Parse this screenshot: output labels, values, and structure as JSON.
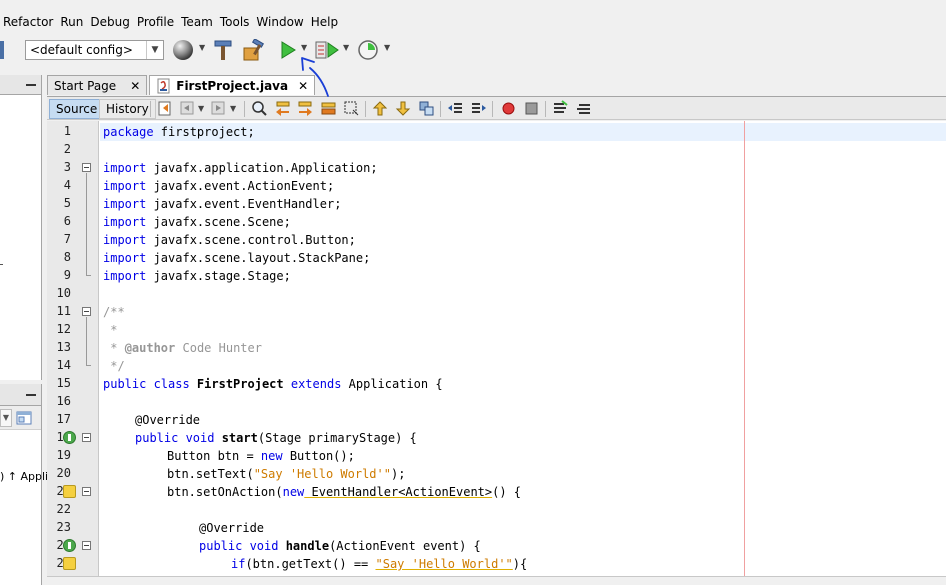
{
  "menu": [
    "Refactor",
    "Run",
    "Debug",
    "Profile",
    "Team",
    "Tools",
    "Window",
    "Help"
  ],
  "toolbar": {
    "config_value": "<default config>",
    "icons": [
      "globe-icon",
      "clean-hammer-icon",
      "build-icon",
      "run-icon",
      "debug-icon",
      "profile-icon"
    ]
  },
  "tabs": [
    {
      "label": "Start Page",
      "active": false
    },
    {
      "label": "FirstProject.java",
      "active": true
    }
  ],
  "editor_toolbar": {
    "source": "Source",
    "history": "History"
  },
  "left_panel": {
    "app_text": ") ↑ Appli"
  },
  "code_lines": [
    {
      "n": "1"
    },
    {
      "n": "2"
    },
    {
      "n": "3"
    },
    {
      "n": "4"
    },
    {
      "n": "5"
    },
    {
      "n": "6"
    },
    {
      "n": "7"
    },
    {
      "n": "8"
    },
    {
      "n": "9"
    },
    {
      "n": "10"
    },
    {
      "n": "11"
    },
    {
      "n": "12"
    },
    {
      "n": "13"
    },
    {
      "n": "14"
    },
    {
      "n": "15"
    },
    {
      "n": "16"
    },
    {
      "n": "17"
    },
    {
      "n": "18"
    },
    {
      "n": "19"
    },
    {
      "n": "20"
    },
    {
      "n": "21"
    },
    {
      "n": "22"
    },
    {
      "n": "23"
    },
    {
      "n": "24"
    },
    {
      "n": "25"
    }
  ],
  "code": {
    "l1_kw": "package",
    "l1_rest": " firstproject;",
    "import_kw": "import",
    "l3": " javafx.application.Application;",
    "l4": " javafx.event.ActionEvent;",
    "l5": " javafx.event.EventHandler;",
    "l6": " javafx.scene.Scene;",
    "l7": " javafx.scene.control.Button;",
    "l8": " javafx.scene.layout.StackPane;",
    "l9": " javafx.stage.Stage;",
    "l11": "/**",
    "l12": " *",
    "l13_a": " * ",
    "l13_tag": "@author",
    "l13_b": " Code Hunter",
    "l14": " */",
    "l15_kw": "public class",
    "l15_name": " FirstProject ",
    "l15_kw2": "extends",
    "l15_rest": " Application {",
    "l17": "@Override",
    "l18_kw": "public void",
    "l18_name": " start",
    "l18_rest": "(Stage primaryStage) {",
    "l19_a": "Button btn = ",
    "l19_kw": "new",
    "l19_b": " Button();",
    "l20_a": "btn.setText(",
    "l20_str": "\"Say 'Hello World'\"",
    "l20_b": ");",
    "l21_a": "btn.setOnAction(",
    "l21_kw": "new",
    "l21_ul": " EventHandler<ActionEvent>",
    "l21_b": "() {",
    "l23": "@Override",
    "l24_kw": "public void",
    "l24_name": " handle",
    "l24_rest": "(ActionEvent event) {",
    "l25_kw": "if",
    "l25_a": "(btn.getText() == ",
    "l25_str": "\"Say 'Hello World'\"",
    "l25_b": "){"
  },
  "colors": {
    "keyword": "#0000e6",
    "comment": "#969696",
    "string": "#ce7b00",
    "annotation_arrow": "#1a3fd6"
  }
}
